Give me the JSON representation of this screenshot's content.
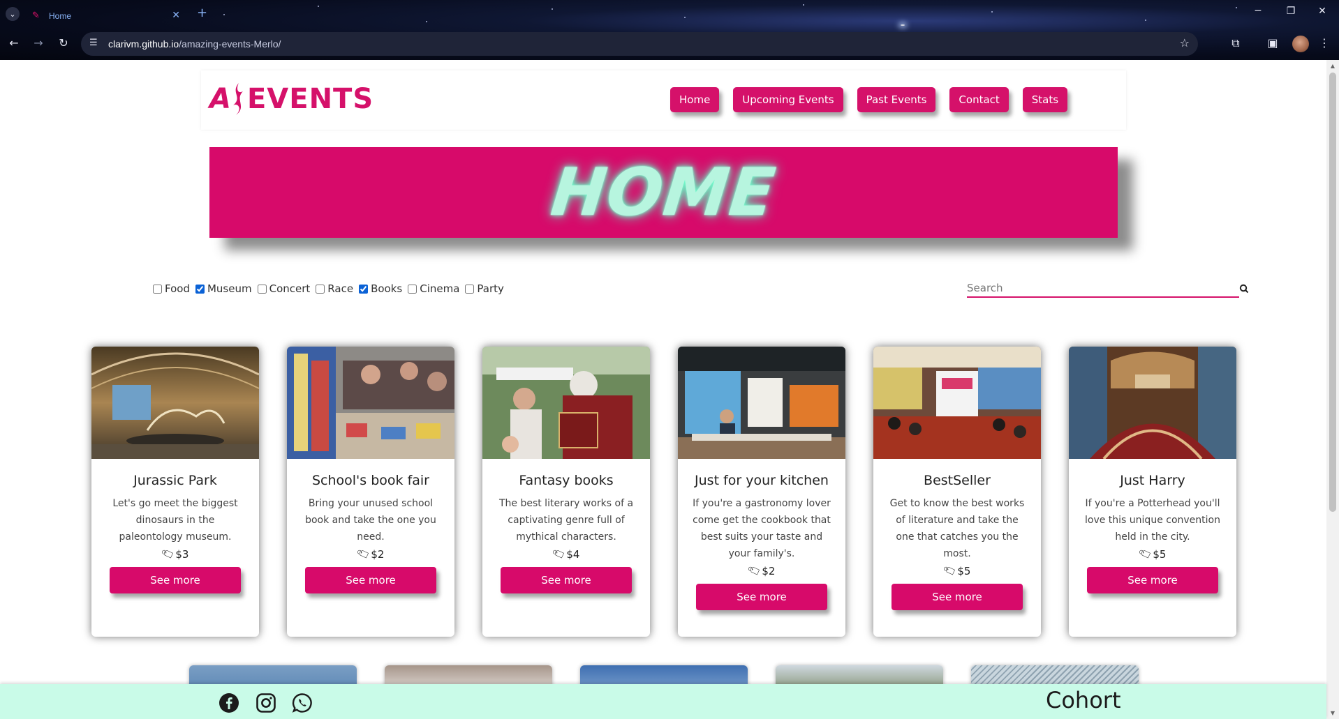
{
  "browser": {
    "tab_title": "Home",
    "url_host": "clarivm.github.io",
    "url_path": "/amazing-events-Merlo/"
  },
  "header": {
    "logo_text": "EVENTS",
    "logo_mark": "A",
    "nav": [
      "Home",
      "Upcoming Events",
      "Past Events",
      "Contact",
      "Stats"
    ]
  },
  "banner": {
    "title": "HOME"
  },
  "filters": {
    "categories": [
      {
        "label": "Food",
        "checked": false
      },
      {
        "label": "Museum",
        "checked": true
      },
      {
        "label": "Concert",
        "checked": false
      },
      {
        "label": "Race",
        "checked": false
      },
      {
        "label": "Books",
        "checked": true
      },
      {
        "label": "Cinema",
        "checked": false
      },
      {
        "label": "Party",
        "checked": false
      }
    ],
    "search_placeholder": "Search"
  },
  "cards": [
    {
      "title": "Jurassic Park",
      "description": "Let's go meet the biggest dinosaurs in the paleontology museum.",
      "price": "$3",
      "button": "See more"
    },
    {
      "title": "School's book fair",
      "description": "Bring your unused school book and take the one you need.",
      "price": "$2",
      "button": "See more"
    },
    {
      "title": "Fantasy books",
      "description": "The best literary works of a captivating genre full of mythical characters.",
      "price": "$4",
      "button": "See more"
    },
    {
      "title": "Just for your kitchen",
      "description": "If you're a gastronomy lover come get the cookbook that best suits your taste and your family's.",
      "price": "$2",
      "button": "See more"
    },
    {
      "title": "BestSeller",
      "description": "Get to know the best works of literature and take the one that catches you the most.",
      "price": "$5",
      "button": "See more"
    },
    {
      "title": "Just Harry",
      "description": "If you're a Potterhead you'll love this unique convention held in the city.",
      "price": "$5",
      "button": "See more"
    }
  ],
  "footer": {
    "social_icons": [
      "facebook-icon",
      "instagram-icon",
      "whatsapp-icon"
    ],
    "brand": "Cohort"
  },
  "colors": {
    "accent": "#d5116a",
    "banner": "#d70a6a",
    "banner_text": "#b7f5df",
    "footer_bg": "#c9fbe8"
  }
}
